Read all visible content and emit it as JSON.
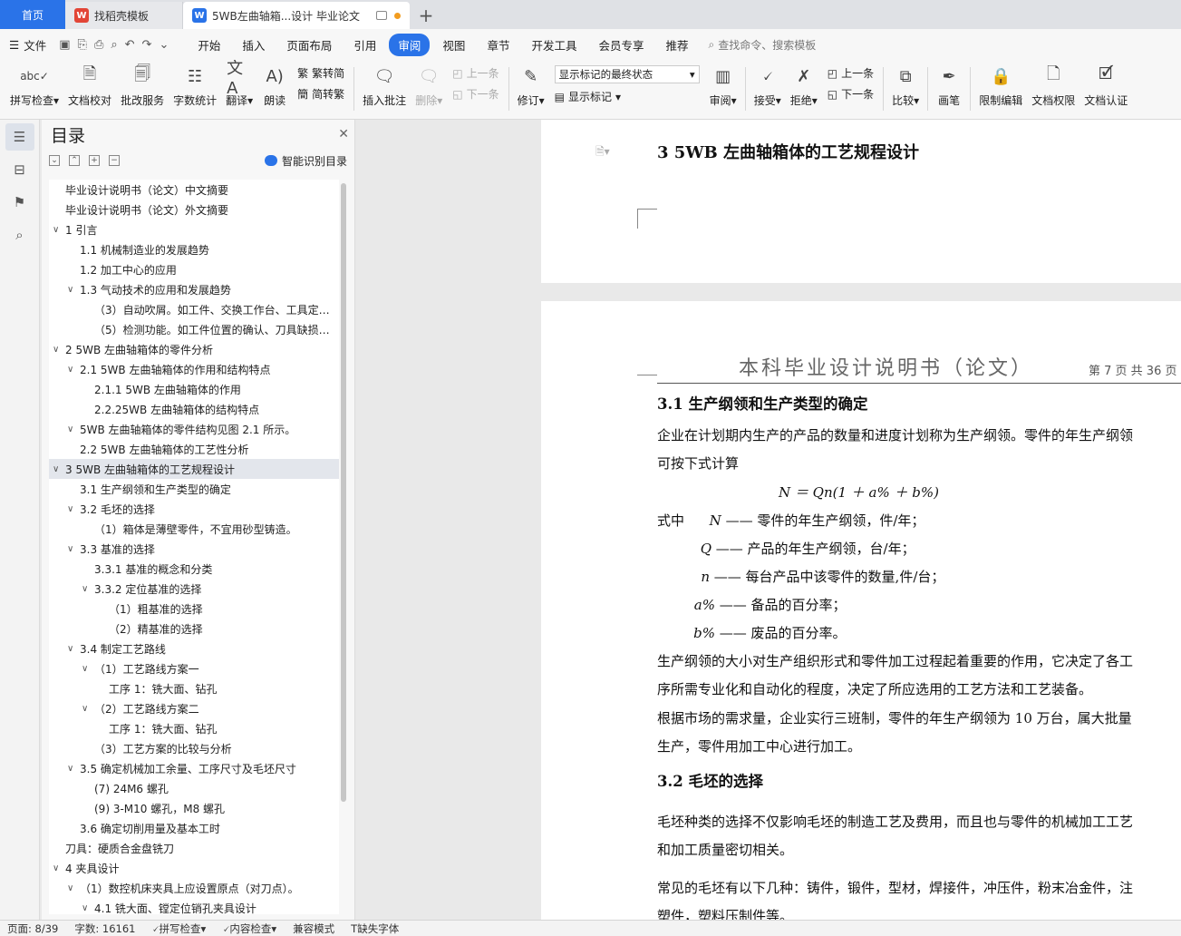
{
  "tabs": {
    "home": "首页",
    "daoke": "找稻壳模板",
    "doc": "5WB左曲轴箱...设计 毕业论文"
  },
  "menu": {
    "file": "文件",
    "items": [
      "开始",
      "插入",
      "页面布局",
      "引用",
      "审阅",
      "视图",
      "章节",
      "开发工具",
      "会员专享",
      "推荐"
    ],
    "active": "审阅",
    "search": "查找命令、搜索模板"
  },
  "ribbon": {
    "spell": "拼写检查",
    "proof": "文档校对",
    "batch": "批改服务",
    "wordcount": "字数统计",
    "translate": "翻译",
    "read": "朗读",
    "trad_to_simp": "繁转简",
    "simp_to_trad": "简转繁",
    "insert_comment": "插入批注",
    "delete": "删除",
    "prev": "上一条",
    "next": "下一条",
    "revise": "修订",
    "markup_state": "显示标记的最终状态",
    "show_markup": "显示标记",
    "review": "审阅",
    "accept": "接受",
    "reject": "拒绝",
    "prev2": "上一条",
    "next2": "下一条",
    "compare": "比较",
    "pen": "画笔",
    "restrict": "限制编辑",
    "perm": "文档权限",
    "cert": "文档认证"
  },
  "toc": {
    "title": "目录",
    "smart": "智能识别目录",
    "items": [
      {
        "text": "毕业设计说明书（论文）中文摘要",
        "indent": 0,
        "caret": ""
      },
      {
        "text": "毕业设计说明书（论文）外文摘要",
        "indent": 0,
        "caret": ""
      },
      {
        "text": "1    引言",
        "indent": 0,
        "caret": "∨"
      },
      {
        "text": "1.1    机械制造业的发展趋势",
        "indent": 1,
        "caret": ""
      },
      {
        "text": "1.2    加工中心的应用",
        "indent": 1,
        "caret": ""
      },
      {
        "text": "1.3    气动技术的应用和发展趋势",
        "indent": 1,
        "caret": "∨"
      },
      {
        "text": "（3）自动吹屑。如工件、交换工作台、工具定…",
        "indent": 2,
        "caret": ""
      },
      {
        "text": "（5）检测功能。如工件位置的确认、刀具缺损…",
        "indent": 2,
        "caret": ""
      },
      {
        "text": "2    5WB 左曲轴箱体的零件分析",
        "indent": 0,
        "caret": "∨"
      },
      {
        "text": "2.1    5WB 左曲轴箱体的作用和结构特点",
        "indent": 1,
        "caret": "∨"
      },
      {
        "text": "2.1.1    5WB 左曲轴箱体的作用",
        "indent": 2,
        "caret": ""
      },
      {
        "text": "2.2.25WB 左曲轴箱体的结构特点",
        "indent": 2,
        "caret": ""
      },
      {
        "text": "5WB 左曲轴箱体的零件结构见图 2.1 所示。",
        "indent": 1,
        "caret": "∨"
      },
      {
        "text": "2.2    5WB 左曲轴箱体的工艺性分析",
        "indent": 1,
        "caret": ""
      },
      {
        "text": "3    5WB 左曲轴箱体的工艺规程设计",
        "indent": 0,
        "caret": "∨",
        "sel": true
      },
      {
        "text": "3.1    生产纲领和生产类型的确定",
        "indent": 1,
        "caret": ""
      },
      {
        "text": "3.2    毛坯的选择",
        "indent": 1,
        "caret": "∨"
      },
      {
        "text": "（1）箱体是薄壁零件，不宜用砂型铸造。",
        "indent": 2,
        "caret": ""
      },
      {
        "text": "3.3    基准的选择",
        "indent": 1,
        "caret": "∨"
      },
      {
        "text": "3.3.1    基准的概念和分类",
        "indent": 2,
        "caret": ""
      },
      {
        "text": "3.3.2    定位基准的选择",
        "indent": 2,
        "caret": "∨"
      },
      {
        "text": "（1）粗基准的选择",
        "indent": 3,
        "caret": ""
      },
      {
        "text": "（2）精基准的选择",
        "indent": 3,
        "caret": ""
      },
      {
        "text": "3.4    制定工艺路线",
        "indent": 1,
        "caret": "∨"
      },
      {
        "text": "（1）工艺路线方案一",
        "indent": 2,
        "caret": "∨"
      },
      {
        "text": "工序 1：铣大面、钻孔",
        "indent": 3,
        "caret": ""
      },
      {
        "text": "（2）工艺路线方案二",
        "indent": 2,
        "caret": "∨"
      },
      {
        "text": "工序 1：铣大面、钻孔",
        "indent": 3,
        "caret": ""
      },
      {
        "text": "（3）工艺方案的比较与分析",
        "indent": 2,
        "caret": ""
      },
      {
        "text": "3.5    确定机械加工余量、工序尺寸及毛坯尺寸",
        "indent": 1,
        "caret": "∨"
      },
      {
        "text": "(7) 24M6 螺孔",
        "indent": 2,
        "caret": ""
      },
      {
        "text": "(9) 3-M10 螺孔，M8 螺孔",
        "indent": 2,
        "caret": ""
      },
      {
        "text": "3.6    确定切削用量及基本工时",
        "indent": 1,
        "caret": ""
      },
      {
        "text": "刀具：硬质合金盘铣刀",
        "indent": 0,
        "caret": ""
      },
      {
        "text": "4    夹具设计",
        "indent": 0,
        "caret": "∨"
      },
      {
        "text": "（1）数控机床夹具上应设置原点（对刀点）。",
        "indent": 1,
        "caret": "∨"
      },
      {
        "text": "4.1    铣大面、镗定位销孔夹具设计",
        "indent": 2,
        "caret": "∨"
      }
    ]
  },
  "doc": {
    "chapter_heading": "3    5WB 左曲轴箱体的工艺规程设计",
    "running_header": "本科毕业设计说明书（论文）",
    "page_label": "第 7 页   共 36 页",
    "sec31": "3.1    生产纲领和生产类型的确定",
    "p1a": "    企业在计划期内生产的产品的数量和进度计划称为生产纲领。零件的年生产纲领",
    "p1b": "可按下式计算",
    "formula": "N ＝ Qn(1 ＋ a% ＋ b%)",
    "def_lead": "式中",
    "defs": [
      {
        "sym": "N",
        "text": "—— 零件的年生产纲领，件/年；"
      },
      {
        "sym": "Q",
        "text": "—— 产品的年生产纲领，台/年；"
      },
      {
        "sym": "n",
        "text": "—— 每台产品中该零件的数量,件/台；"
      },
      {
        "sym": "a%",
        "text": "—— 备品的百分率；"
      },
      {
        "sym": "b%",
        "text": "—— 废品的百分率。"
      }
    ],
    "p2a": "    生产纲领的大小对生产组织形式和零件加工过程起着重要的作用，它决定了各工",
    "p2b": "序所需专业化和自动化的程度，决定了所应选用的工艺方法和工艺装备。",
    "p3a": "    根据市场的需求量，企业实行三班制，零件的年生产纲领为 10 万台，属大批量",
    "p3b": "生产，零件用加工中心进行加工。",
    "sec32": "3.2    毛坯的选择",
    "p4a": "    毛坯种类的选择不仅影响毛坯的制造工艺及费用，而且也与零件的机械加工工艺",
    "p4b": "和加工质量密切相关。",
    "p5a": "    常见的毛坯有以下几种：铸件，锻件，型材，焊接件，冲压件，粉末冶金件，注",
    "p5b": "塑件，塑料压制件等。"
  },
  "status": {
    "page": "页面: 8/39",
    "words": "字数: 16161",
    "spell": "拼写检查",
    "content": "内容检查",
    "compat": "兼容模式",
    "font": "缺失字体"
  }
}
